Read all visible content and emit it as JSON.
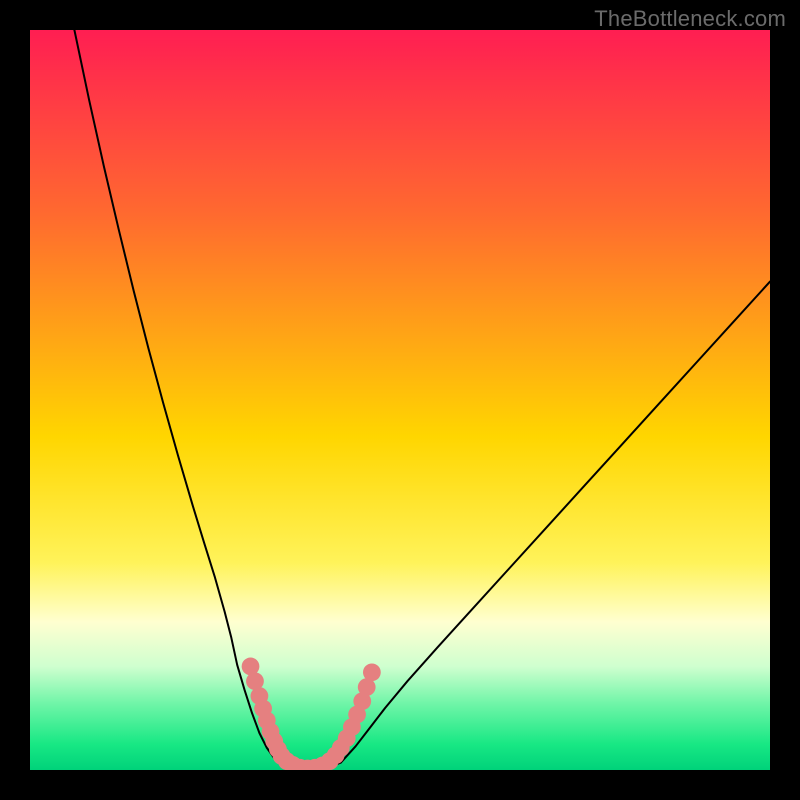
{
  "watermark": "TheBottleneck.com",
  "chart_data": {
    "type": "line",
    "title": "",
    "xlabel": "",
    "ylabel": "",
    "xlim": [
      0,
      100
    ],
    "ylim": [
      0,
      100
    ],
    "background_gradient": {
      "stops": [
        {
          "offset": 0,
          "color": "#ff1e52"
        },
        {
          "offset": 0.25,
          "color": "#ff6a2f"
        },
        {
          "offset": 0.55,
          "color": "#ffd600"
        },
        {
          "offset": 0.72,
          "color": "#fff35a"
        },
        {
          "offset": 0.8,
          "color": "#ffffd0"
        },
        {
          "offset": 0.86,
          "color": "#cfffcf"
        },
        {
          "offset": 0.91,
          "color": "#70f5a8"
        },
        {
          "offset": 0.965,
          "color": "#18e884"
        },
        {
          "offset": 1.0,
          "color": "#00d27a"
        }
      ]
    },
    "series": [
      {
        "name": "bottleneck-curve-left",
        "stroke": "#000000",
        "stroke_width": 2,
        "x": [
          6.0,
          8.0,
          10.0,
          12.0,
          14.0,
          16.0,
          18.0,
          20.0,
          22.0,
          23.5,
          25.0,
          26.3,
          27.2,
          28.0,
          29.0,
          30.0,
          31.0,
          32.0,
          33.0,
          34.0
        ],
        "y": [
          100.0,
          90.5,
          81.5,
          73.0,
          64.8,
          57.0,
          49.6,
          42.5,
          35.7,
          30.8,
          26.0,
          21.4,
          17.9,
          14.2,
          10.8,
          7.7,
          5.0,
          3.0,
          1.6,
          0.8
        ]
      },
      {
        "name": "bottleneck-curve-bottom",
        "stroke": "#000000",
        "stroke_width": 2,
        "x": [
          34.0,
          35.0,
          36.0,
          37.0,
          38.0,
          39.0,
          40.0,
          41.0,
          42.0
        ],
        "y": [
          0.8,
          0.3,
          0.1,
          0.0,
          0.0,
          0.1,
          0.3,
          0.6,
          1.0
        ]
      },
      {
        "name": "bottleneck-curve-right",
        "stroke": "#000000",
        "stroke_width": 2,
        "x": [
          42.0,
          44.0,
          46.0,
          48.0,
          51.0,
          55.0,
          60.0,
          65.0,
          70.0,
          75.0,
          80.0,
          85.0,
          90.0,
          95.0,
          100.0
        ],
        "y": [
          1.0,
          3.2,
          5.8,
          8.4,
          12.0,
          16.5,
          22.0,
          27.5,
          33.0,
          38.5,
          44.0,
          49.5,
          55.0,
          60.5,
          66.0
        ]
      }
    ],
    "dot_overlay": {
      "name": "curve-dots",
      "fill": "#e58080",
      "radius_data_units": 1.2,
      "points": [
        {
          "x": 29.8,
          "y": 14.0
        },
        {
          "x": 30.4,
          "y": 12.0
        },
        {
          "x": 31.0,
          "y": 10.0
        },
        {
          "x": 31.5,
          "y": 8.3
        },
        {
          "x": 32.0,
          "y": 6.7
        },
        {
          "x": 32.5,
          "y": 5.2
        },
        {
          "x": 33.0,
          "y": 3.9
        },
        {
          "x": 33.5,
          "y": 2.8
        },
        {
          "x": 34.0,
          "y": 1.9
        },
        {
          "x": 34.7,
          "y": 1.2
        },
        {
          "x": 35.5,
          "y": 0.7
        },
        {
          "x": 36.5,
          "y": 0.3
        },
        {
          "x": 37.5,
          "y": 0.2
        },
        {
          "x": 38.5,
          "y": 0.3
        },
        {
          "x": 39.5,
          "y": 0.6
        },
        {
          "x": 40.5,
          "y": 1.2
        },
        {
          "x": 41.3,
          "y": 2.0
        },
        {
          "x": 42.0,
          "y": 3.0
        },
        {
          "x": 42.8,
          "y": 4.3
        },
        {
          "x": 43.5,
          "y": 5.8
        },
        {
          "x": 44.2,
          "y": 7.5
        },
        {
          "x": 44.9,
          "y": 9.3
        },
        {
          "x": 45.5,
          "y": 11.2
        },
        {
          "x": 46.2,
          "y": 13.2
        }
      ]
    }
  }
}
